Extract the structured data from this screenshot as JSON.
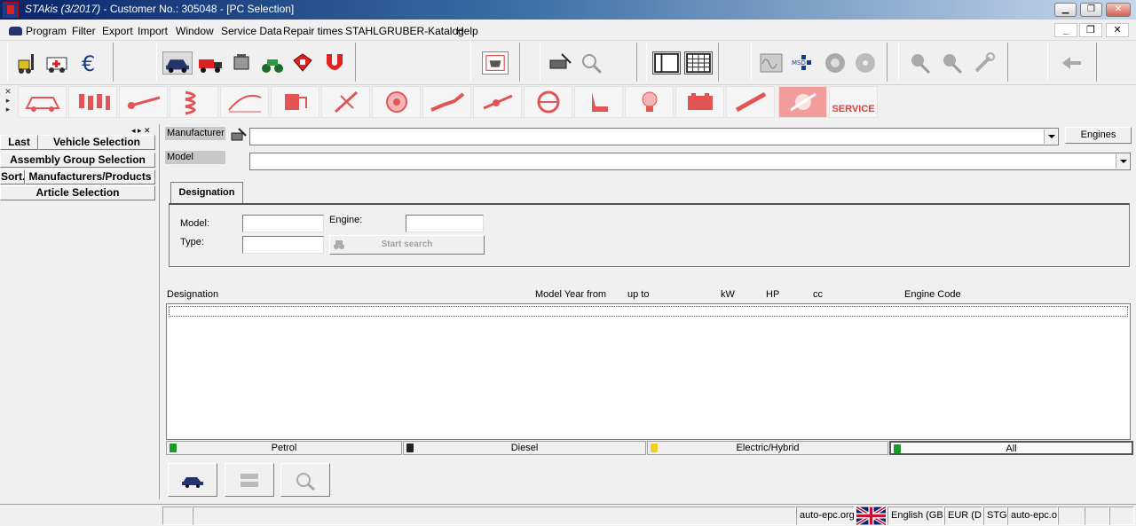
{
  "window": {
    "title_app": "STAkis (3/2017)",
    "title_rest": " - Customer No.: 305048 - [PC Selection]"
  },
  "menu": {
    "items": [
      "Program",
      "Filter",
      "Export",
      "Import",
      "Window",
      "Service Data",
      "Repair times",
      "STAHLGRUBER-Katalog",
      "Help"
    ]
  },
  "left_panel": {
    "last": "Last",
    "vehicle_selection": "Vehicle Selection",
    "assembly_group_selection": "Assembly Group Selection",
    "sort": "Sort.",
    "manufacturers_products": "Manufacturers/Products",
    "article_selection": "Article Selection"
  },
  "selection": {
    "manufacturer_label": "Manufacturer",
    "model_label": "Model",
    "engines_button": "Engines",
    "manufacturer_value": "",
    "model_value": ""
  },
  "search": {
    "tab": "Designation",
    "model_label": "Model:",
    "type_label": "Type:",
    "engine_label": "Engine:",
    "start_search": "Start search",
    "model_value": "",
    "type_value": "",
    "engine_value": ""
  },
  "results": {
    "columns": [
      "Designation",
      "Model Year from",
      "up to",
      "kW",
      "HP",
      "cc",
      "Engine Code"
    ],
    "rows": []
  },
  "fuel_filters": [
    "Petrol",
    "Diesel",
    "Electric/Hybrid",
    "All"
  ],
  "category_service_label": "SERVICE",
  "status": {
    "site1": "auto-epc.org",
    "language": "English (GB)",
    "currency": "EUR (D)",
    "code": "STG",
    "site2": "auto-epc.or"
  }
}
